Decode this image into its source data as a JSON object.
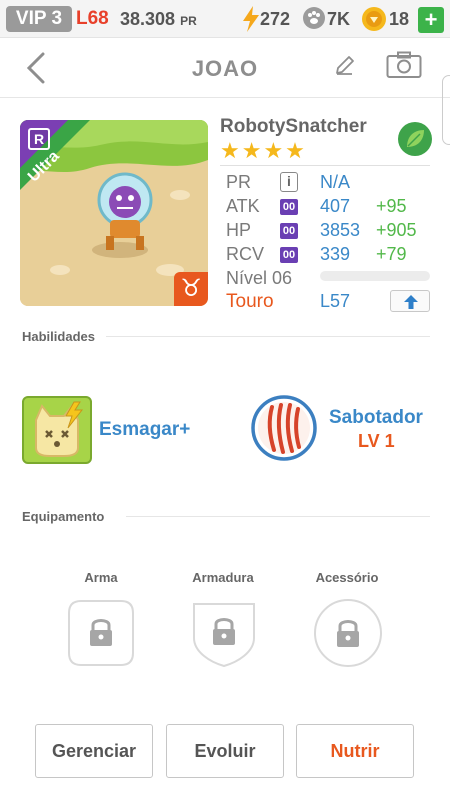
{
  "status": {
    "vip": "VIP 3",
    "level": "L68",
    "pr_value": "38.308",
    "pr_unit": "PR",
    "energy": "272",
    "paws": "7K",
    "coins": "18",
    "plus": "+"
  },
  "header": {
    "title": "JOAO",
    "back_icon": "chevron-left-icon",
    "edit_icon": "pencil-icon",
    "camera_icon": "camera-icon"
  },
  "monster": {
    "name": "RobotySnatcher",
    "rank": "R",
    "rarity": "Ultra",
    "stars": "★★★★",
    "element_icon": "leaf-icon",
    "zodiac_symbol": "♉",
    "stats": {
      "pr_label": "PR",
      "pr_value": "N/A",
      "atk_label": "ATK",
      "atk_badge": "00",
      "atk_value": "407",
      "atk_bonus": "+95",
      "hp_label": "HP",
      "hp_badge": "00",
      "hp_value": "3853",
      "hp_bonus": "+905",
      "rcv_label": "RCV",
      "rcv_badge": "00",
      "rcv_value": "339",
      "rcv_bonus": "+79",
      "level_label": "Nível 06",
      "level_progress": 0,
      "zodiac_name": "Touro",
      "max_level": "L57"
    }
  },
  "skills": {
    "section_title": "Habilidades",
    "items": [
      {
        "name": "Esmagar+"
      },
      {
        "name": "Sabotador",
        "level": "LV 1"
      }
    ]
  },
  "equipment": {
    "section_title": "Equipamento",
    "slots": [
      "Arma",
      "Armadura",
      "Acessório"
    ]
  },
  "actions": {
    "manage": "Gerenciar",
    "evolve": "Evoluir",
    "feed": "Nutrir"
  },
  "colors": {
    "accent_blue": "#3a88c8",
    "accent_orange": "#e8581e",
    "bonus_green": "#52b84a",
    "star_gold": "#f5b81c"
  }
}
